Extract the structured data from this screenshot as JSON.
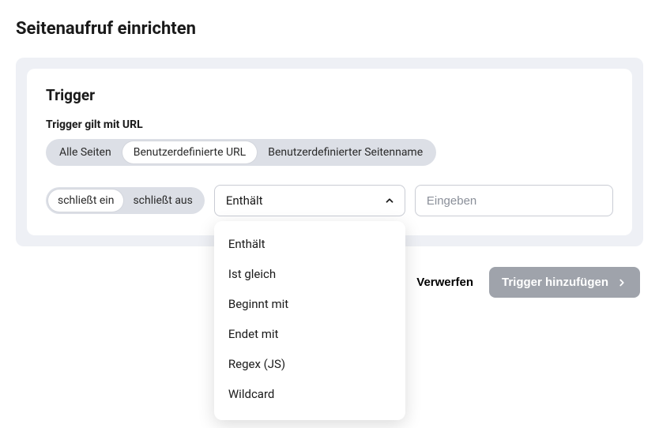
{
  "page": {
    "title": "Seitenaufruf einrichten"
  },
  "card": {
    "title": "Trigger",
    "urlSectionLabel": "Trigger gilt mit URL"
  },
  "urlScope": {
    "items": [
      {
        "label": "Alle Seiten"
      },
      {
        "label": "Benutzerdefinierte URL"
      },
      {
        "label": "Benutzerdefinierter Seitenname"
      }
    ],
    "activeIndex": 1
  },
  "includeExclude": {
    "items": [
      {
        "label": "schließt ein"
      },
      {
        "label": "schließt aus"
      }
    ],
    "activeIndex": 0
  },
  "matcher": {
    "selected": "Enthält",
    "options": [
      "Enthält",
      "Ist gleich",
      "Beginnt mit",
      "Endet mit",
      "Regex (JS)",
      "Wildcard"
    ]
  },
  "valueInput": {
    "placeholder": "Eingeben"
  },
  "footer": {
    "discard": "Verwerfen",
    "submit": "Trigger hinzufügen"
  }
}
